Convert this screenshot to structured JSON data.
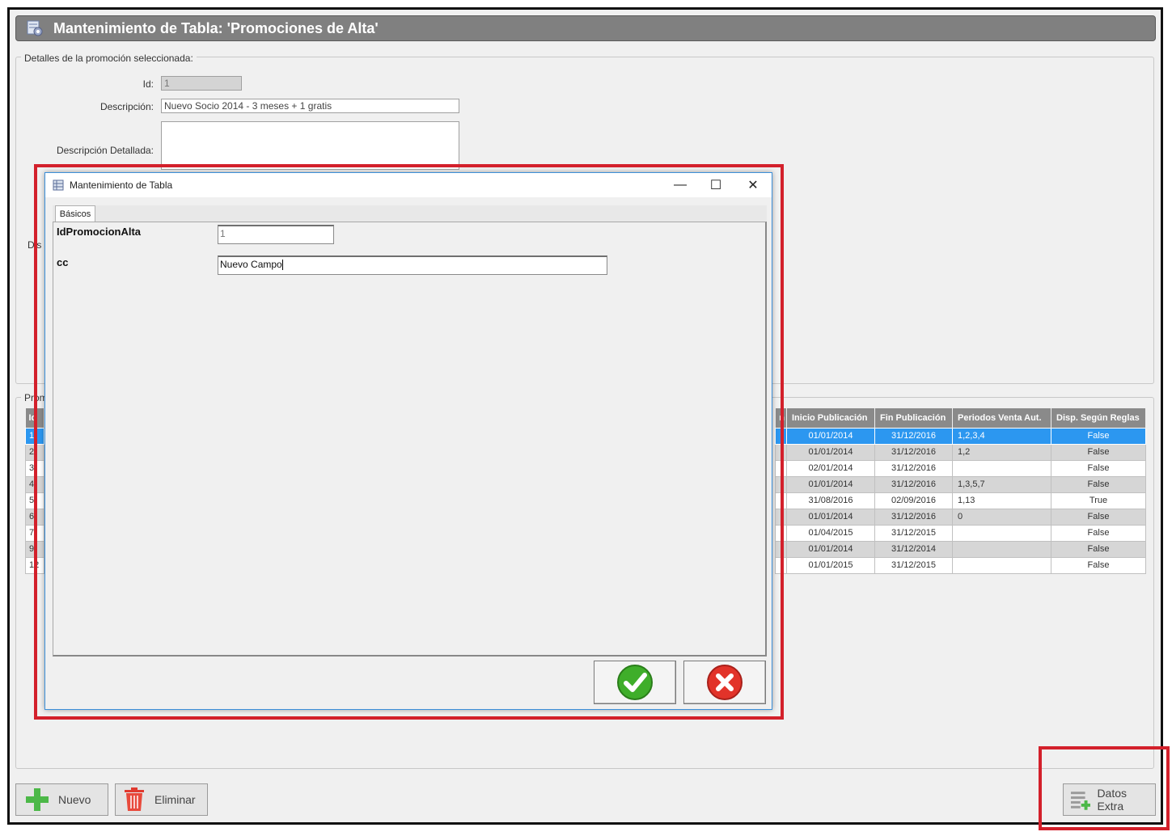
{
  "window": {
    "title": "Mantenimiento de Tabla: 'Promociones de Alta'"
  },
  "details": {
    "legend": "Detalles de la promoción seleccionada:",
    "id_label": "Id:",
    "id_value": "1",
    "desc_label": "Descripción:",
    "desc_value": "Nuevo Socio 2014 - 3 meses + 1 gratis",
    "desc_det_label": "Descripción Detallada:",
    "partial_label": "Dis"
  },
  "list": {
    "legend_partial": "Prom",
    "columns": [
      "Inicio Publicación",
      "Fin Publicación",
      "Periodos Venta Aut.",
      "Disp. Según Reglas"
    ],
    "id_col_partial": "Id",
    "partial_col_tail": "n",
    "rows": [
      {
        "id": "1",
        "inicio": "01/01/2014",
        "fin": "31/12/2016",
        "periodos": "1,2,3,4",
        "disp": "False",
        "selected": true
      },
      {
        "id": "2",
        "inicio": "01/01/2014",
        "fin": "31/12/2016",
        "periodos": "1,2",
        "disp": "False"
      },
      {
        "id": "3",
        "inicio": "02/01/2014",
        "fin": "31/12/2016",
        "periodos": "",
        "disp": "False"
      },
      {
        "id": "4",
        "inicio": "01/01/2014",
        "fin": "31/12/2016",
        "periodos": "1,3,5,7",
        "disp": "False"
      },
      {
        "id": "5",
        "inicio": "31/08/2016",
        "fin": "02/09/2016",
        "periodos": "1,13",
        "disp": "True"
      },
      {
        "id": "6",
        "inicio": "01/01/2014",
        "fin": "31/12/2016",
        "periodos": "0",
        "disp": "False"
      },
      {
        "id": "7",
        "inicio": "01/04/2015",
        "fin": "31/12/2015",
        "periodos": "",
        "disp": "False"
      },
      {
        "id": "9",
        "inicio": "01/01/2014",
        "fin": "31/12/2014",
        "periodos": "",
        "disp": "False"
      },
      {
        "id": "12",
        "inicio": "01/01/2015",
        "fin": "31/12/2015",
        "periodos": "",
        "disp": "False"
      }
    ]
  },
  "buttons": {
    "nuevo": "Nuevo",
    "eliminar": "Eliminar",
    "datos_extra": "Datos Extra"
  },
  "dialog": {
    "title": "Mantenimiento de Tabla",
    "tab": "Básicos",
    "field1_label": "IdPromocionAlta",
    "field1_value": "1",
    "field2_label": "cc",
    "field2_value": "Nuevo Campo",
    "minimize": "—",
    "maximize": "☐",
    "close": "✕"
  },
  "colors": {
    "highlight_red": "#d3202b",
    "selection_blue": "#2c97f0",
    "header_gray": "#808080"
  }
}
